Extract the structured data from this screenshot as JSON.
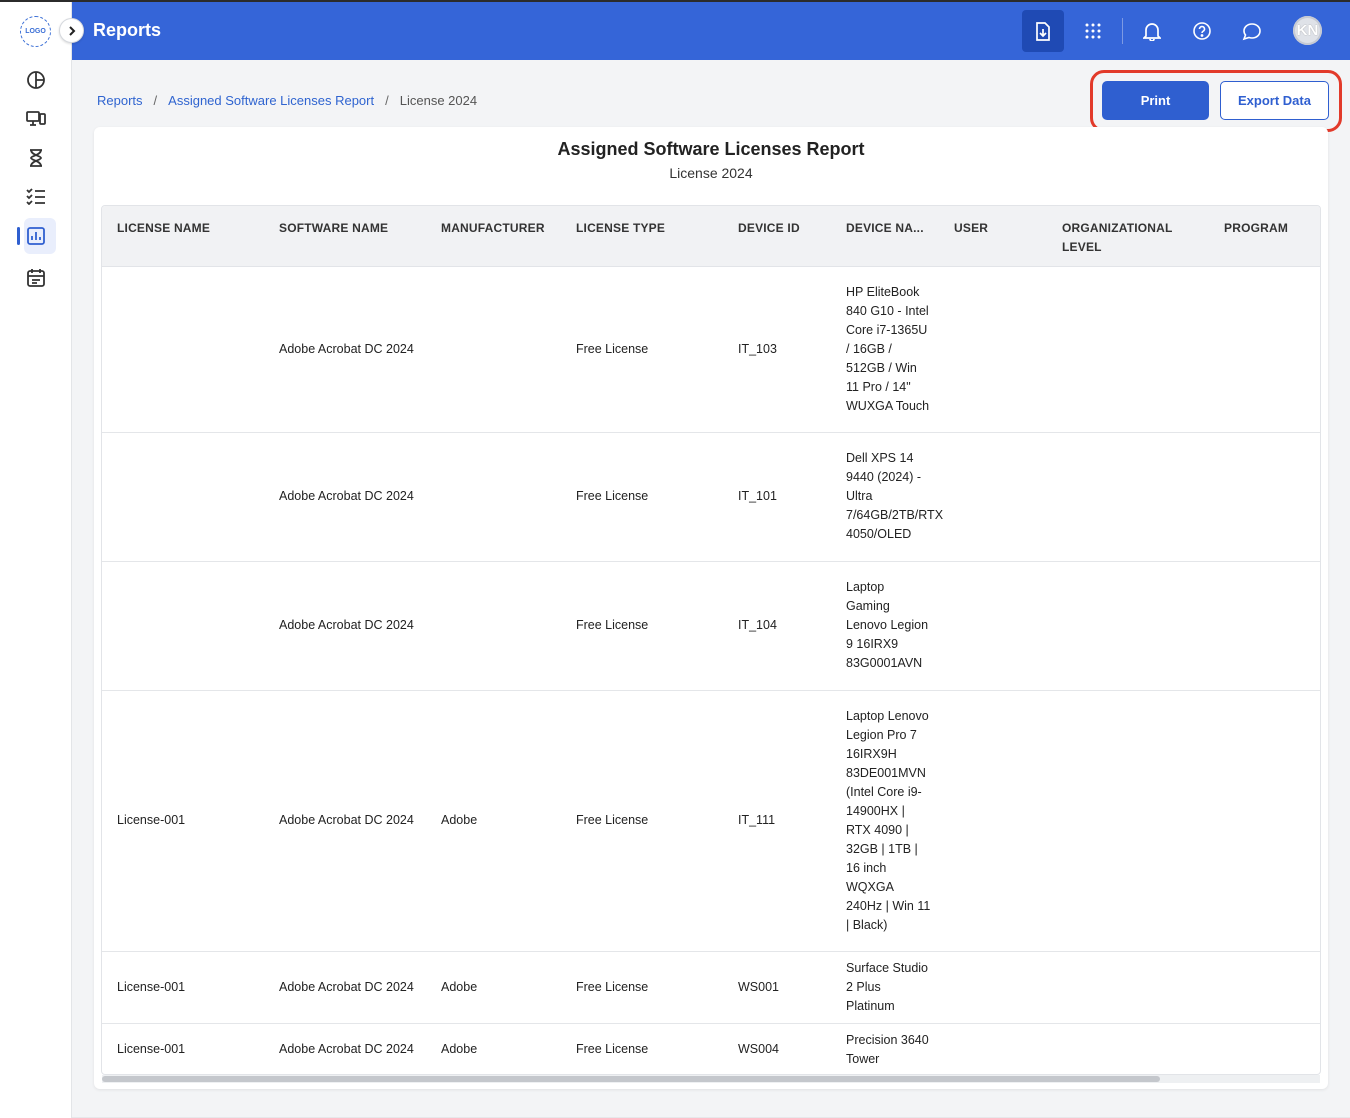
{
  "app": {
    "logo_text": "LOGO",
    "header_title": "Reports",
    "avatar_initials": "KN",
    "accent_color": "#3565d8"
  },
  "sidebar": {
    "items": [
      {
        "icon": "pie-chart-icon"
      },
      {
        "icon": "devices-icon"
      },
      {
        "icon": "hourglass-icon"
      },
      {
        "icon": "checklist-icon"
      },
      {
        "icon": "reports-icon",
        "active": true
      },
      {
        "icon": "calendar-icon"
      }
    ]
  },
  "header_icons": [
    "download-file-icon",
    "apps-grid-icon",
    "bell-icon",
    "help-icon",
    "chat-icon"
  ],
  "breadcrumb": {
    "items": [
      "Reports",
      "Assigned Software Licenses Report"
    ],
    "current": "License 2024",
    "separator": "/"
  },
  "actions": {
    "print_label": "Print",
    "export_label": "Export Data"
  },
  "report": {
    "title": "Assigned Software Licenses Report",
    "subtitle": "License 2024",
    "columns": [
      "LICENSE NAME",
      "SOFTWARE NAME",
      "MANUFACTURER",
      "LICENSE TYPE",
      "DEVICE ID",
      "DEVICE NA...",
      "USER",
      "ORGANIZATIONAL LEVEL",
      "PROGRAM"
    ],
    "rows": [
      {
        "license_name": "",
        "software_name": "Adobe Acrobat DC 2024",
        "manufacturer": "",
        "license_type": "Free License",
        "device_id": "IT_103",
        "device_name": "HP EliteBook 840 G10 - Intel Core i7-1365U / 16GB / 512GB / Win 11 Pro / 14\" WUXGA Touch",
        "user": "",
        "org_level": "",
        "program": ""
      },
      {
        "license_name": "",
        "software_name": "Adobe Acrobat DC 2024",
        "manufacturer": "",
        "license_type": "Free License",
        "device_id": "IT_101",
        "device_name": "Dell XPS 14 9440 (2024) - Ultra 7/64GB/2TB/RTX 4050/OLED",
        "user": "",
        "org_level": "",
        "program": ""
      },
      {
        "license_name": "",
        "software_name": "Adobe Acrobat DC 2024",
        "manufacturer": "",
        "license_type": "Free License",
        "device_id": "IT_104",
        "device_name": "Laptop Gaming Lenovo Legion 9 16IRX9 83G0001AVN",
        "user": "",
        "org_level": "",
        "program": ""
      },
      {
        "license_name": "License-001",
        "software_name": "Adobe Acrobat DC 2024",
        "manufacturer": "Adobe",
        "license_type": "Free License",
        "device_id": "IT_111",
        "device_name": "Laptop Lenovo Legion Pro 7 16IRX9H 83DE001MVN (Intel Core i9-14900HX | RTX 4090 | 32GB | 1TB | 16 inch WQXGA 240Hz | Win 11 | Black)",
        "user": "",
        "org_level": "",
        "program": ""
      },
      {
        "license_name": "License-001",
        "software_name": "Adobe Acrobat DC 2024",
        "manufacturer": "Adobe",
        "license_type": "Free License",
        "device_id": "WS001",
        "device_name": "Surface Studio 2 Plus Platinum",
        "user": "",
        "org_level": "",
        "program": ""
      },
      {
        "license_name": "License-001",
        "software_name": "Adobe Acrobat DC 2024",
        "manufacturer": "Adobe",
        "license_type": "Free License",
        "device_id": "WS004",
        "device_name": "Precision 3640 Tower",
        "user": "",
        "org_level": "",
        "program": ""
      }
    ]
  }
}
